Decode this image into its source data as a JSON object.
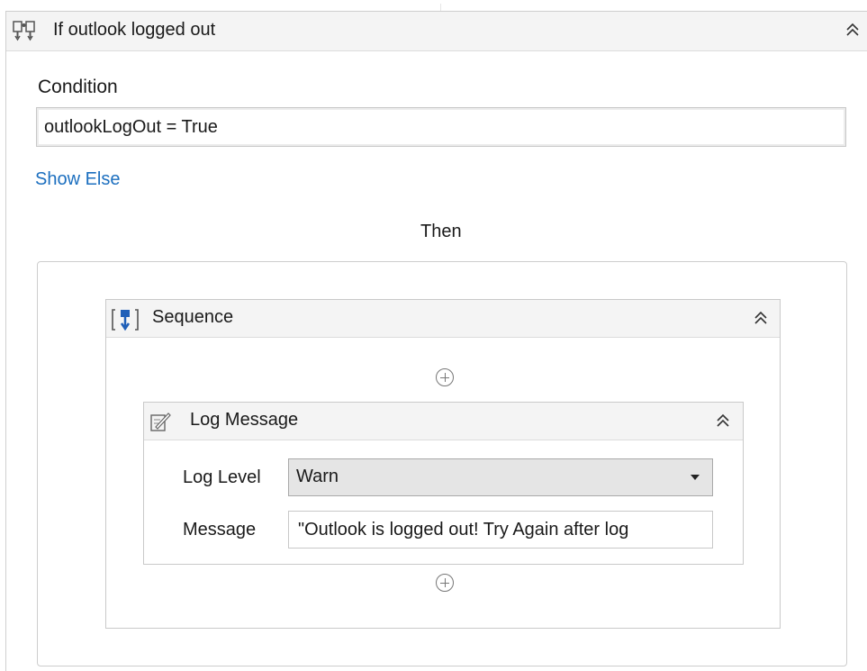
{
  "if_activity": {
    "title": "If outlook logged out",
    "icon": "if-branch-icon",
    "collapse_icon": "collapse-up-icon",
    "condition_label": "Condition",
    "condition_value": "outlookLogOut = True",
    "show_else_label": "Show Else",
    "then_label": "Then"
  },
  "sequence": {
    "title": "Sequence",
    "icon": "sequence-icon",
    "collapse_icon": "collapse-up-icon",
    "add_icon": "add-activity-icon"
  },
  "log_message": {
    "title": "Log Message",
    "icon": "log-message-icon",
    "collapse_icon": "collapse-up-icon",
    "level_label": "Log Level",
    "level_value": "Warn",
    "message_label": "Message",
    "message_value": "\"Outlook is logged out! Try Again after log"
  },
  "colors": {
    "link": "#1c6fbf",
    "header_bg": "#f4f4f4",
    "icon_blue": "#1f5fb8"
  }
}
